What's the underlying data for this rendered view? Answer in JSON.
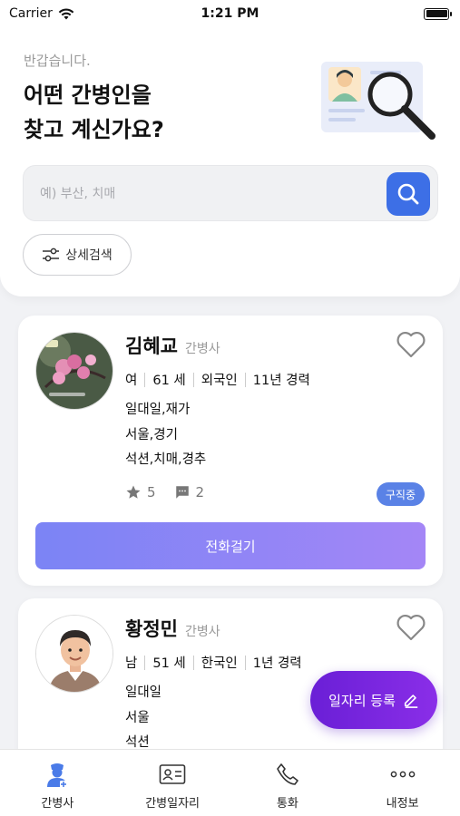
{
  "status_bar": {
    "carrier": "Carrier",
    "time": "1:21 PM"
  },
  "header": {
    "greeting": "반갑습니다.",
    "headline_line1": "어떤 간병인을",
    "headline_line2": "찾고 계신가요?"
  },
  "search": {
    "placeholder": "예) 부산, 치매",
    "value": ""
  },
  "detail_search_label": "상세검색",
  "caregivers": [
    {
      "name": "김혜교",
      "role": "간병사",
      "gender": "여",
      "age": "61 세",
      "nationality": "외국인",
      "experience": "11년 경력",
      "care_type": "일대일,재가",
      "region": "서울,경기",
      "specialties": "석션,치매,경추",
      "rating": "5",
      "reviews": "2",
      "status": "구직중",
      "call_label": "전화걸기"
    },
    {
      "name": "황정민",
      "role": "간병사",
      "gender": "남",
      "age": "51 세",
      "nationality": "한국인",
      "experience": "1년 경력",
      "care_type": "일대일",
      "region": "서울",
      "specialties": "석션"
    }
  ],
  "fab_label": "일자리 등록",
  "tabs": [
    {
      "label": "간병사",
      "icon": "nurse-icon",
      "active": true
    },
    {
      "label": "간병일자리",
      "icon": "id-card-icon"
    },
    {
      "label": "통화",
      "icon": "phone-icon"
    },
    {
      "label": "내정보",
      "icon": "more-icon"
    }
  ],
  "colors": {
    "primary": "#3d6fe6",
    "call_gradient_start": "#7b84f5",
    "call_gradient_end": "#a486f6",
    "fab": "#7a27df",
    "badge": "#5a82e6"
  }
}
